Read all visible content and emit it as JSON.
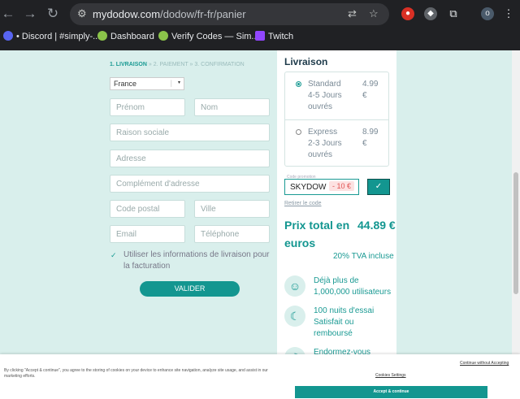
{
  "browser": {
    "url_host": "mydodow.com",
    "url_path": "/dodow/fr-fr/panier",
    "profile_initial": "o",
    "bookmarks": [
      {
        "label": "• Discord | #simply-...",
        "color": "#5865f2"
      },
      {
        "label": "Dashboard",
        "color": "#8bc34a"
      },
      {
        "label": "Verify Codes — Sim...",
        "color": "#8bc34a"
      },
      {
        "label": "Twitch",
        "color": "#9146ff"
      }
    ]
  },
  "checkout": {
    "breadcrumb": {
      "step1": "1. LIVRAISON",
      "rest": "» 2. PAIEMENT » 3. CONFIRMATION"
    },
    "country": "France",
    "fields": {
      "prenom": "Prénom",
      "nom": "Nom",
      "raison_sociale": "Raison sociale",
      "adresse": "Adresse",
      "complement": "Complément d'adresse",
      "code_postal": "Code postal",
      "ville": "Ville",
      "email": "Email",
      "telephone": "Téléphone"
    },
    "billing_checkbox_label": "Utiliser les informations de livraison pour la facturation",
    "valider": "VALIDER"
  },
  "summary": {
    "livraison_title": "Livraison",
    "options": [
      {
        "name": "Standard",
        "delay": "4-5 Jours ouvrés",
        "price": "4.99 €",
        "selected": true
      },
      {
        "name": "Express",
        "delay": "2-3 Jours ouvrés",
        "price": "8.99 €",
        "selected": false
      }
    ],
    "promo_caption": "Code promotion",
    "promo_code": "SKYDOW",
    "promo_discount": "- 10 €",
    "retirer": "Retirer le code",
    "total_label": "Prix total en euros",
    "total_amount": "44.89 €",
    "tva": "20% TVA incluse",
    "features": [
      {
        "icon": "smiley-icon",
        "text": "Déjà plus de 1,000,000 utilisateurs"
      },
      {
        "icon": "moon-icon",
        "text": "100 nuits d'essai Satisfait ou remboursé"
      },
      {
        "icon": "sleep-icon",
        "text": "Endormez-vous"
      }
    ]
  },
  "cookie": {
    "text": "By clicking \"Accept & continue\", you agree to the storing of cookies on your device to enhance site navigation, analyze site usage, and assist in our marketing efforts.",
    "continue_without": "Continue without Accepting",
    "settings": "Cookies Settings",
    "accept": "Accept & continue"
  },
  "colors": {
    "accent": "#139690",
    "page_bg": "#d9efec"
  }
}
